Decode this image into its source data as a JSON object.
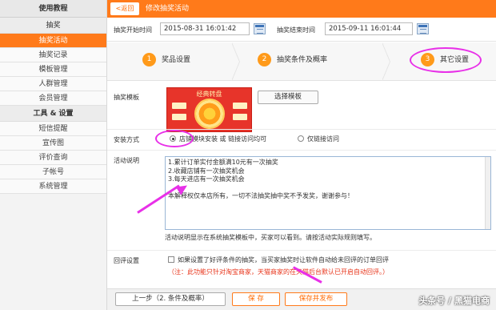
{
  "sidebar": {
    "tutorial": "使用教程",
    "lottery_group": "抽奖",
    "items1": [
      "抽奖活动",
      "抽奖记录",
      "模板管理",
      "人群管理",
      "会员管理"
    ],
    "tools_group": "工具 & 设置",
    "items2": [
      "短信提醒",
      "宣传图",
      "评价查询",
      "子帐号",
      "系统管理"
    ]
  },
  "topbar": {
    "back": "<返回",
    "title": "修改抽奖活动"
  },
  "time": {
    "start_label": "抽奖开始时间",
    "start_value": "2015-08-31 16:01:42",
    "end_label": "抽奖结束时间",
    "end_value": "2015-09-11 16:01:44"
  },
  "steps": [
    {
      "num": "1",
      "label": "奖品设置"
    },
    {
      "num": "2",
      "label": "抽奖条件及概率"
    },
    {
      "num": "3",
      "label": "其它设置"
    }
  ],
  "form": {
    "template_label": "抽奖模板",
    "template_name": "经典转盘",
    "select_template": "选择模板",
    "install_label": "安装方式",
    "install_opt1": "店铺模块安装 或 链接访问均可",
    "install_opt2": "仅链接访问",
    "desc_label": "活动说明",
    "desc_lines": [
      "1.累计订单实付金额满10元有一次抽奖",
      "2.收藏店铺有一次抽奖机会",
      "3.每天进店有一次抽奖机会",
      "",
      "本解释权仅本店所有，一切不法抽奖抽中奖不予发奖，谢谢参与！"
    ],
    "desc_hint": "活动说明显示在系统抽奖模板中，买家可以看到。请按活动实际规则填写。",
    "review_label": "回评设置",
    "review_opt": "如果设置了好评条件的抽奖，当买家抽奖时让软件自动给未回评的订单回评",
    "review_note": "（注：此功能只针对淘宝商家，天猫商家的在天猫后台默认已开启自动回评。）"
  },
  "footer": {
    "prev": "上一步（2. 条件及概率）",
    "save": "保 存",
    "save_publish": "保存并发布",
    "watermark": "头条号 / 黑猫电商"
  },
  "colors": {
    "accent": "#ff7a1a",
    "annotation": "#e830e8",
    "note_red": "#e8341a"
  }
}
